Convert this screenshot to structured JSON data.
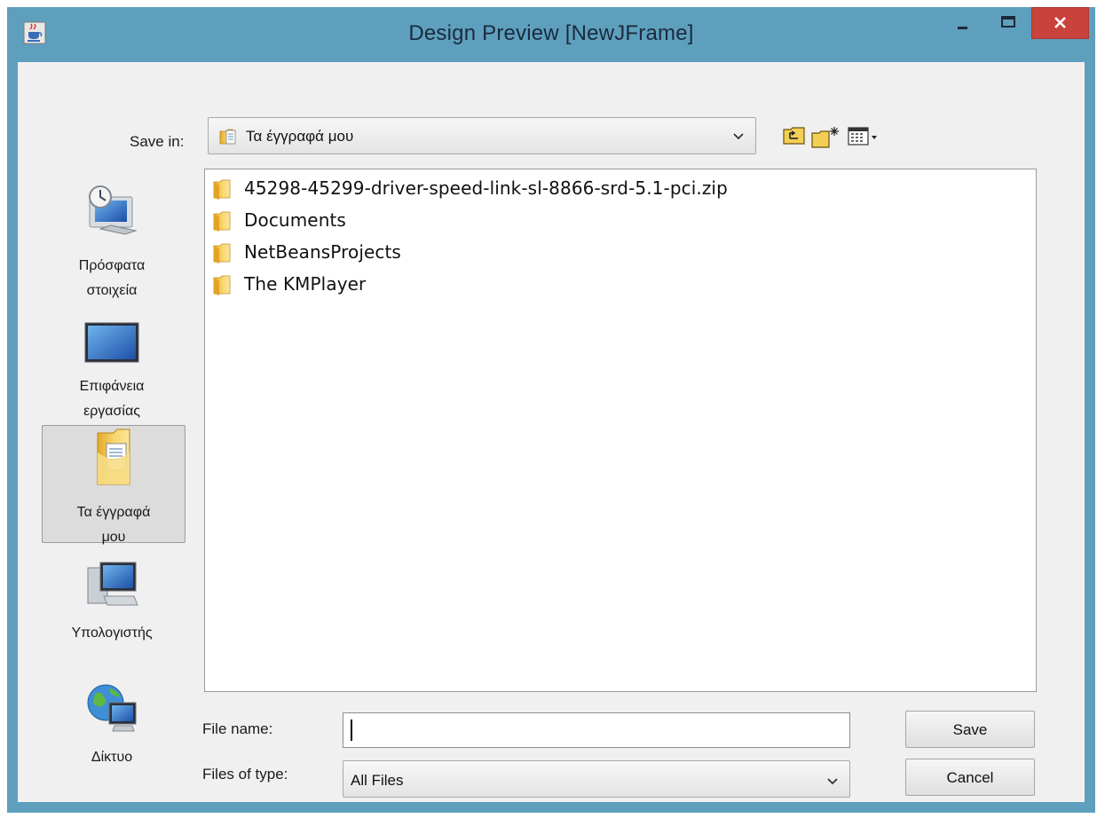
{
  "window": {
    "title": "Design Preview [NewJFrame]",
    "icons": {
      "app": "java-cup-icon",
      "minimize": "minimize-icon",
      "maximize": "maximize-icon",
      "close": "close-icon"
    },
    "colors": {
      "titlebar": "#5e9fbe",
      "close": "#c9433c"
    }
  },
  "toolbar": {
    "save_in_label": "Save in:",
    "save_in_value": "Τα έγγραφά μου",
    "icons": [
      "up-one-level-icon",
      "create-new-folder-icon",
      "view-menu-icon"
    ]
  },
  "places": [
    {
      "label_1": "Πρόσφατα",
      "label_2": "στοιχεία",
      "icon": "recent-items-icon"
    },
    {
      "label_1": "Επιφάνεια",
      "label_2": "εργασίας",
      "icon": "desktop-icon"
    },
    {
      "label_1": "Τα έγγραφά",
      "label_2": "μου",
      "icon": "my-documents-icon",
      "selected": true
    },
    {
      "label_1": "Υπολογιστής",
      "label_2": "",
      "icon": "computer-icon"
    },
    {
      "label_1": "Δίκτυο",
      "label_2": "",
      "icon": "network-icon"
    }
  ],
  "files": [
    {
      "name": "45298-45299-driver-speed-link-sl-8866-srd-5.1-pci.zip",
      "icon": "folder-icon"
    },
    {
      "name": "Documents",
      "icon": "folder-icon"
    },
    {
      "name": "NetBeansProjects",
      "icon": "folder-icon"
    },
    {
      "name": "The KMPlayer",
      "icon": "folder-icon"
    }
  ],
  "form": {
    "file_name_label": "File name:",
    "file_name_value": "",
    "files_of_type_label": "Files of type:",
    "files_of_type_value": "All Files"
  },
  "buttons": {
    "save": "Save",
    "cancel": "Cancel"
  }
}
